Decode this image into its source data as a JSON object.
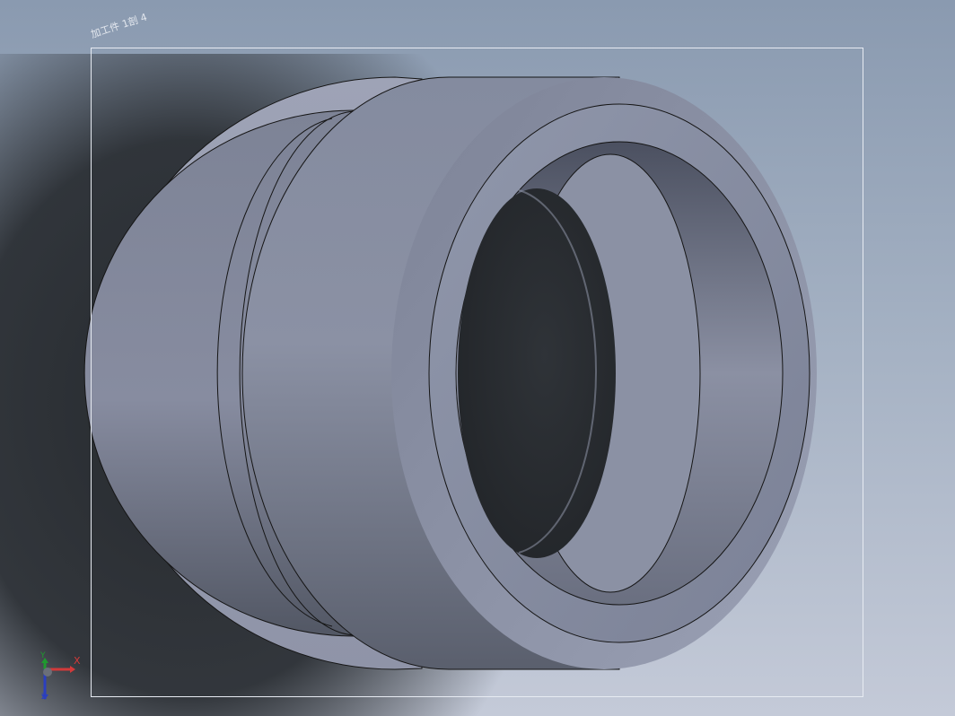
{
  "viewport": {
    "sheet_label": "加工件 1剖 4",
    "model": "cylindrical-bushing-part"
  },
  "triad": {
    "x_label": "X",
    "y_label": "Y",
    "z_label": "Z"
  },
  "colors": {
    "background_top": "#8a9ab0",
    "background_bottom": "#c4cad8",
    "shadow": "#24272b",
    "part_body": "#8289a0",
    "part_light": "#9aa0b6",
    "outline": "#151515",
    "axis_x": "#d23a3a",
    "axis_y": "#1f9a2f",
    "axis_z": "#2b3fbf"
  }
}
